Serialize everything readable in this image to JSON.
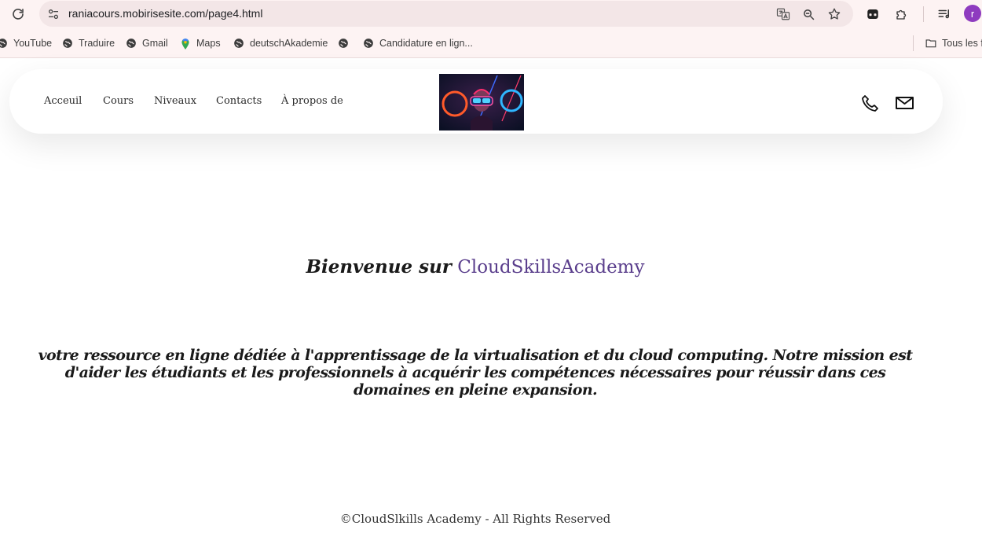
{
  "browser": {
    "url": "raniacours.mobirisesite.com/page4.html",
    "profile_initial": "r",
    "bookmarks": [
      "YouTube",
      "Traduire",
      "Gmail",
      "Maps",
      "deutschAkademie",
      "",
      "Candidature en lign...",
      "Tous les f"
    ]
  },
  "nav": {
    "links": [
      "Acceuil",
      "Cours",
      "Niveaux",
      "Contacts",
      "À propos de"
    ]
  },
  "hero": {
    "welcome_prefix": "Bienvenue sur",
    "brand": "CloudSkillsAcademy",
    "brand_color": "#5a3e8c",
    "description": "votre ressource en ligne dédiée à l'apprentissage de la virtualisation et du cloud computing. Notre mission est d'aider les étudiants et les professionnels à acquérir les compétences nécessaires pour réussir dans ces domaines en pleine expansion."
  },
  "footer": {
    "text": "©CloudSlkills Academy - All Rights Reserved"
  }
}
